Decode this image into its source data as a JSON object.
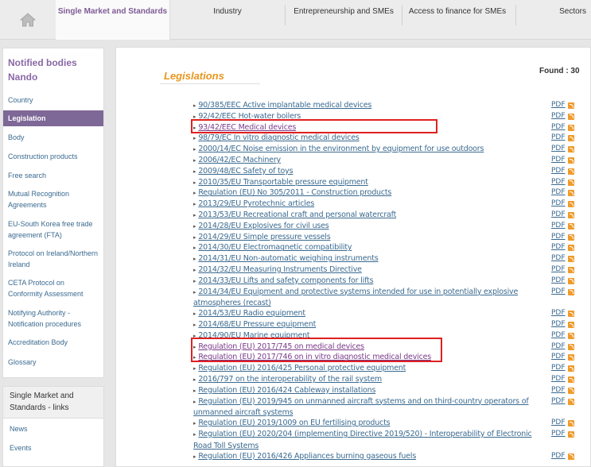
{
  "nav": {
    "items": [
      "Single Market and Standards",
      "Industry",
      "Entrepreneurship and SMEs",
      "Access to finance for SMEs",
      "Sectors"
    ]
  },
  "sidebar": {
    "title": "Notified bodies Nando",
    "items": [
      "Country",
      "Legislation",
      "Body",
      "Construction products",
      "Free search",
      "Mutual Recognition Agreements",
      "EU-South Korea free trade agreement (FTA)",
      "Protocol on Ireland/Northern Ireland",
      "CETA Protocol on Conformity Assessment",
      "Notifying Authority - Notification procedures",
      "Accreditation Body",
      "Glossary"
    ]
  },
  "sidebar2": {
    "title": "Single Market and Standards - links",
    "items": [
      "News",
      "Events"
    ]
  },
  "main": {
    "title": "Legislations",
    "found_label": "Found : 30",
    "pdf_label": "PDF",
    "rows": [
      {
        "line1": "90/385/EEC Active implantable medical devices",
        "line2": ""
      },
      {
        "line1": "92/42/EEC Hot-water boilers",
        "line2": ""
      },
      {
        "line1": "93/42/EEC Medical devices",
        "line2": ""
      },
      {
        "line1": "98/79/EC In vitro diagnostic medical devices",
        "line2": ""
      },
      {
        "line1": "2000/14/EC Noise emission in the environment by equipment for use outdoors",
        "line2": ""
      },
      {
        "line1": "2006/42/EC Machinery",
        "line2": ""
      },
      {
        "line1": "2009/48/EC Safety of toys",
        "line2": ""
      },
      {
        "line1": "2010/35/EU Transportable pressure equipment",
        "line2": ""
      },
      {
        "line1": "Regulation (EU) No 305/2011 - Construction products",
        "line2": ""
      },
      {
        "line1": "2013/29/EU Pyrotechnic articles",
        "line2": ""
      },
      {
        "line1": "2013/53/EU Recreational craft and personal watercraft",
        "line2": ""
      },
      {
        "line1": "2014/28/EU Explosives for civil uses",
        "line2": ""
      },
      {
        "line1": "2014/29/EU Simple pressure vessels",
        "line2": ""
      },
      {
        "line1": "2014/30/EU Electromagnetic compatibility",
        "line2": ""
      },
      {
        "line1": "2014/31/EU Non-automatic weighing instruments",
        "line2": ""
      },
      {
        "line1": "2014/32/EU Measuring Instruments Directive",
        "line2": ""
      },
      {
        "line1": "2014/33/EU Lifts and safety components for lifts",
        "line2": ""
      },
      {
        "line1": "2014/34/EU Equipment and protective systems intended for use in potentially explosive",
        "line2": "atmospheres (recast)"
      },
      {
        "line1": "2014/53/EU Radio equipment",
        "line2": ""
      },
      {
        "line1": "2014/68/EU Pressure equipment",
        "line2": ""
      },
      {
        "line1": "2014/90/EU Marine equipment",
        "line2": ""
      },
      {
        "line1": "Regulation (EU) 2017/745 on medical devices",
        "line2": ""
      },
      {
        "line1": "Regulation (EU) 2017/746 on in vitro diagnostic medical devices",
        "line2": ""
      },
      {
        "line1": "Regulation (EU) 2016/425 Personal protective equipment",
        "line2": ""
      },
      {
        "line1": "2016/797 on the interoperability of the rail system",
        "line2": ""
      },
      {
        "line1": "Regulation (EU) 2016/424 Cableway installations",
        "line2": ""
      },
      {
        "line1": "Regulation (EU) 2019/945 on unmanned aircraft systems and on third-country operators of",
        "line2": "unmanned aircraft systems"
      },
      {
        "line1": "Regulation (EU) 2019/1009 on EU fertilising products",
        "line2": ""
      },
      {
        "line1": "Regulation (EU) 2020/204 (implementing Directive 2019/520) - Interoperability of Electronic",
        "line2": "Road Toll Systems"
      },
      {
        "line1": "Regulation (EU) 2016/426 Appliances burning gaseous fuels",
        "line2": ""
      }
    ]
  },
  "colors": {
    "accent_purple": "#7e6897",
    "title_orange": "#e8961e",
    "link_blue": "#3a6a90",
    "highlight_red": "#e02020",
    "rss_orange": "#f09a2a"
  }
}
